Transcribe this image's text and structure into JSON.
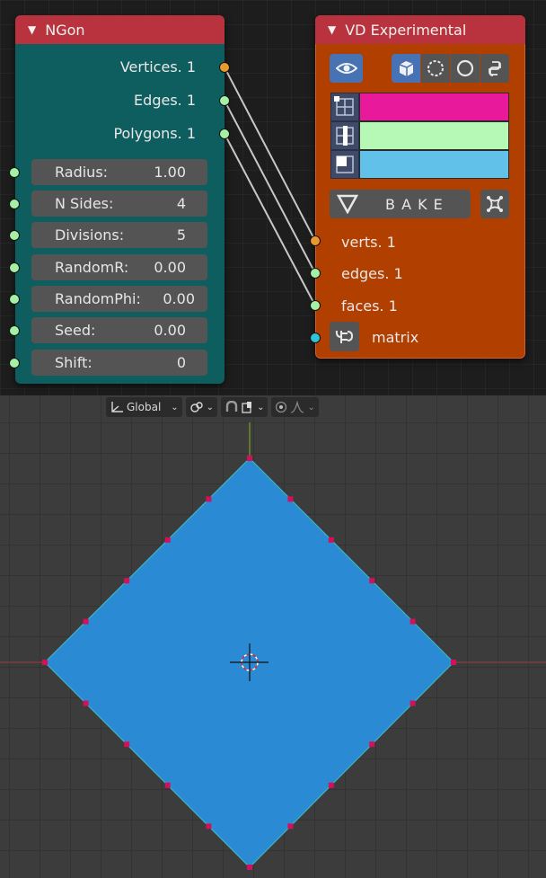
{
  "ngon_node": {
    "title": "NGon",
    "outputs": [
      "Vertices. 1",
      "Edges. 1",
      "Polygons. 1"
    ],
    "fields": [
      {
        "label": "Radius:",
        "value": "1.00"
      },
      {
        "label": "N Sides:",
        "value": "4"
      },
      {
        "label": "Divisions:",
        "value": "5"
      },
      {
        "label": "RandomR:",
        "value": "0.00"
      },
      {
        "label": "RandomPhi:",
        "value": "0.00"
      },
      {
        "label": "Seed:",
        "value": "0.00"
      },
      {
        "label": "Shift:",
        "value": "0"
      }
    ]
  },
  "vd_node": {
    "title": "VD Experimental",
    "bake_label": "B A K E",
    "inputs": [
      "verts. 1",
      "edges. 1",
      "faces. 1",
      "matrix"
    ],
    "colors": {
      "vertex": "#e8199a",
      "edge": "#b6f8b6",
      "face": "#62c1e8"
    }
  },
  "viewport": {
    "transform_orientation": "Global",
    "mesh_fill": "#2a8bd4",
    "vertex_color": "#d4105a"
  }
}
